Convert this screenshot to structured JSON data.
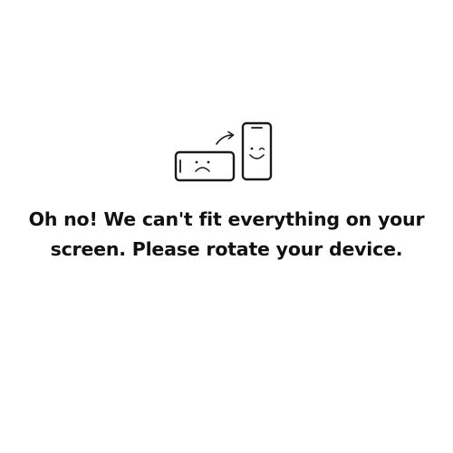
{
  "message": {
    "line1": "Oh no! We can't fit everything on your",
    "line2": "screen. Please rotate your device."
  },
  "illustration": {
    "landscape_phone_icon": "sad-landscape-phone-icon",
    "portrait_phone_icon": "smiling-portrait-phone-icon",
    "arrow_icon": "rotate-arrow-icon"
  },
  "colors": {
    "background": "#ffffff",
    "text": "#111111",
    "stroke": "#1a1a1a"
  }
}
